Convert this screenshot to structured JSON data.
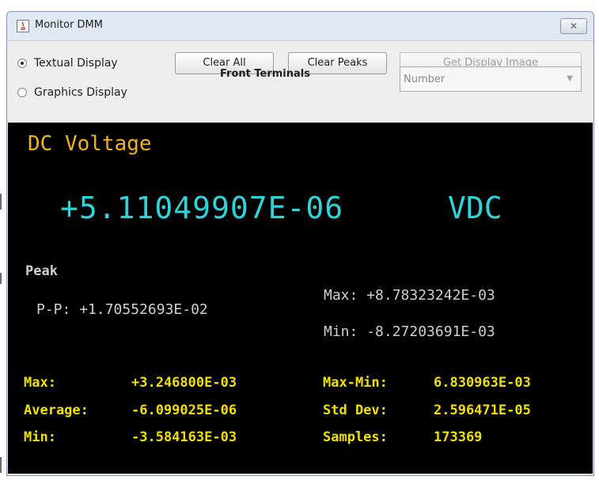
{
  "window": {
    "title": "Monitor DMM",
    "close_glyph": "✕"
  },
  "toolbar": {
    "radio_textual": "Textual Display",
    "radio_graphics": "Graphics Display",
    "selected_radio": "Textual Display",
    "clear_all": "Clear All",
    "clear_peaks": "Clear Peaks",
    "get_display_image": "Get Display Image",
    "front_terminals": "Front Terminals",
    "format_select": "Number"
  },
  "display": {
    "mode": "DC Voltage",
    "reading": "+5.11049907E-06",
    "unit": "VDC",
    "peak": {
      "label": "Peak",
      "pp_label": "P-P:",
      "pp_value": "+1.70552693E-02",
      "max_label": "Max:",
      "max_value": "+8.78323242E-03",
      "min_label": "Min:",
      "min_value": "-8.27203691E-03"
    },
    "stats": {
      "max_label": "Max:",
      "max_value": "+3.246800E-03",
      "avg_label": "Average:",
      "avg_value": "-6.099025E-06",
      "min_label": "Min:",
      "min_value": "-3.584163E-03",
      "maxmin_label": "Max-Min:",
      "maxmin_value": "6.830963E-03",
      "std_label": "Std Dev:",
      "std_value": "2.596471E-05",
      "samples_label": "Samples:",
      "samples_value": "173369"
    }
  },
  "colors": {
    "mode_text": "#f3b320",
    "reading_text": "#2fd3d8",
    "peak_text": "#d0d0d0",
    "stats_text": "#f0e000",
    "display_bg": "#000000"
  }
}
